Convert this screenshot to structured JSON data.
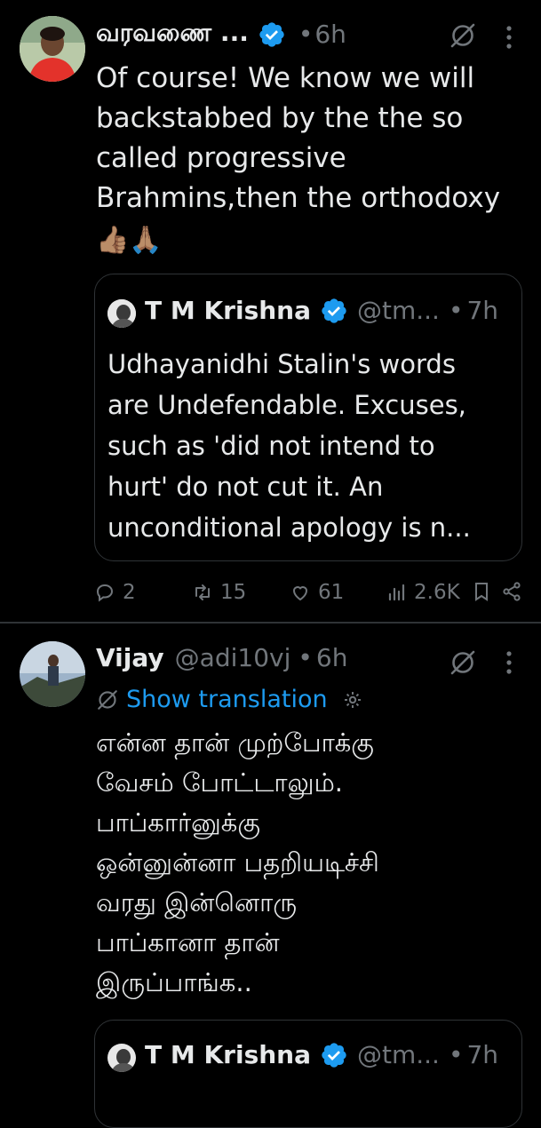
{
  "tweets": [
    {
      "name": "வரவணை ...",
      "time": "6h",
      "text": "Of course! We know we will\nbackstabbed by the the so\ncalled progressive\nBrahmins,then the orthodoxy",
      "emoji": "👍🏽🙏🏽",
      "quote": {
        "name": "T M Krishna",
        "handle": "@tm...",
        "time": "7h",
        "text": "Udhayanidhi Stalin's words\nare Undefendable. Excuses,\nsuch as 'did not intend to\nhurt' do not cut it. An\nunconditional apology is n..."
      },
      "actions": {
        "replies": "2",
        "reposts": "15",
        "likes": "61",
        "views": "2.6K"
      }
    },
    {
      "name": "Vijay",
      "handle": "@adi10vj",
      "time": "6h",
      "show_translation": "Show translation",
      "text": "என்ன தான் முற்போக்கு\nவேசம் போட்டாலும்.\nபாப்கார்னுக்கு\nஒன்னுன்னா பதறியடிச்சி\nவரது இன்னொரு\nபாப்கானா தான்\nஇருப்பாங்க..",
      "quote": {
        "name": "T M Krishna",
        "handle": "@tm...",
        "time": "7h"
      }
    }
  ],
  "colors": {
    "background": "#000000",
    "text": "#e7e9ea",
    "secondary": "#71767b",
    "accent": "#1d9bf0",
    "divider": "#2f3336"
  }
}
